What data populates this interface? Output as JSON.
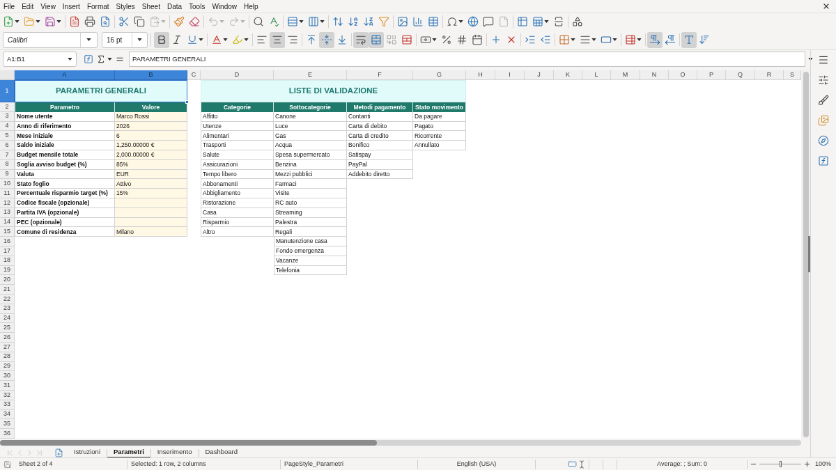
{
  "menu_bar": [
    "File",
    "Edit",
    "View",
    "Insert",
    "Format",
    "Styles",
    "Sheet",
    "Data",
    "Tools",
    "Window",
    "Help"
  ],
  "standard_toolbar": [
    [
      {
        "kind": "new-document",
        "disabled": false
      },
      {
        "kind": "open",
        "disabled": false
      },
      {
        "kind": "save",
        "disabled": false
      }
    ],
    [
      {
        "kind": "export-pdf",
        "disabled": false
      },
      {
        "kind": "print",
        "disabled": false
      },
      {
        "kind": "print-preview",
        "disabled": false
      }
    ],
    [
      {
        "kind": "cut",
        "disabled": false
      },
      {
        "kind": "copy",
        "disabled": false
      },
      {
        "kind": "paste",
        "disabled": true
      }
    ],
    [
      {
        "kind": "clone-formatting",
        "disabled": false
      },
      {
        "kind": "clear-formatting",
        "disabled": false
      }
    ],
    [
      {
        "kind": "undo",
        "disabled": true
      },
      {
        "kind": "redo",
        "disabled": true
      }
    ],
    [
      {
        "kind": "find-replace",
        "disabled": false
      },
      {
        "kind": "spelling",
        "disabled": false
      }
    ],
    [
      {
        "kind": "row",
        "disabled": false
      },
      {
        "kind": "column",
        "disabled": false
      }
    ],
    [
      {
        "kind": "sort",
        "disabled": false
      },
      {
        "kind": "sort-ascending",
        "disabled": false
      },
      {
        "kind": "sort-descending",
        "disabled": false
      },
      {
        "kind": "autofilter",
        "disabled": false
      }
    ],
    [
      {
        "kind": "image",
        "disabled": false
      },
      {
        "kind": "chart",
        "disabled": false
      },
      {
        "kind": "pivot-table",
        "disabled": false
      }
    ],
    [
      {
        "kind": "special-character",
        "disabled": false
      },
      {
        "kind": "hyperlink",
        "disabled": false
      },
      {
        "kind": "comment",
        "disabled": false
      },
      {
        "kind": "header-footer",
        "disabled": true
      }
    ],
    [
      {
        "kind": "print-area",
        "disabled": false
      },
      {
        "kind": "freeze",
        "disabled": false
      },
      {
        "kind": "split-window",
        "disabled": false
      }
    ],
    [
      {
        "kind": "shapes",
        "disabled": false
      }
    ]
  ],
  "formatting_toolbar": {
    "font_name": "Calibri",
    "font_size": "16 pt",
    "groups": [
      [
        {
          "kind": "bold",
          "on": true
        },
        {
          "kind": "italic",
          "on": false
        },
        {
          "kind": "underline",
          "on": false
        }
      ],
      [
        {
          "kind": "font-color",
          "on": false
        },
        {
          "kind": "highlighting",
          "on": false
        }
      ],
      [
        {
          "kind": "align-left",
          "on": false
        },
        {
          "kind": "align-center",
          "on": true
        },
        {
          "kind": "align-right",
          "on": false
        }
      ],
      [
        {
          "kind": "align-top",
          "on": false
        },
        {
          "kind": "align-middle",
          "on": true
        },
        {
          "kind": "align-bottom",
          "on": false
        }
      ],
      [
        {
          "kind": "wrap-text",
          "on": true
        },
        {
          "kind": "merge-center",
          "on": true
        },
        {
          "kind": "merge-cells",
          "on": false
        },
        {
          "kind": "unmerge-cells",
          "on": false
        }
      ],
      [
        {
          "kind": "currency",
          "on": false
        },
        {
          "kind": "percent",
          "on": false
        },
        {
          "kind": "number",
          "on": false
        },
        {
          "kind": "date",
          "on": false
        }
      ],
      [
        {
          "kind": "add-decimal",
          "on": false
        },
        {
          "kind": "delete-decimal",
          "on": false
        }
      ],
      [
        {
          "kind": "increase-indent",
          "on": false
        },
        {
          "kind": "decrease-indent",
          "on": false
        }
      ],
      [
        {
          "kind": "borders",
          "on": false
        },
        {
          "kind": "border-style",
          "on": false
        },
        {
          "kind": "border-color",
          "on": false
        }
      ],
      [
        {
          "kind": "conditional",
          "on": false
        }
      ],
      [
        {
          "kind": "left-to-right",
          "on": true
        },
        {
          "kind": "right-to-left",
          "on": false
        }
      ],
      [
        {
          "kind": "text-direction",
          "on": true
        },
        {
          "kind": "stacked-text",
          "on": false
        }
      ]
    ]
  },
  "formula_bar": {
    "name_box": "A1:B1",
    "content": "PARAMETRI GENERALI"
  },
  "sheet": {
    "columns": [
      {
        "label": "A",
        "selected": true
      },
      {
        "label": "B",
        "selected": true
      },
      {
        "label": "C",
        "selected": false
      },
      {
        "label": "D",
        "selected": false
      },
      {
        "label": "E",
        "selected": false
      },
      {
        "label": "F",
        "selected": false
      },
      {
        "label": "G",
        "selected": false
      },
      {
        "label": "H",
        "selected": false
      },
      {
        "label": "I",
        "selected": false
      },
      {
        "label": "J",
        "selected": false
      },
      {
        "label": "K",
        "selected": false
      },
      {
        "label": "L",
        "selected": false
      },
      {
        "label": "M",
        "selected": false
      },
      {
        "label": "N",
        "selected": false
      },
      {
        "label": "O",
        "selected": false
      },
      {
        "label": "P",
        "selected": false
      },
      {
        "label": "Q",
        "selected": false
      },
      {
        "label": "R",
        "selected": false
      },
      {
        "label": "S",
        "selected": false
      }
    ],
    "rows": [
      {
        "label": "1",
        "selected": true
      },
      {
        "label": "2",
        "selected": false
      },
      {
        "label": "3",
        "selected": false
      },
      {
        "label": "4",
        "selected": false
      },
      {
        "label": "5",
        "selected": false
      },
      {
        "label": "6",
        "selected": false
      },
      {
        "label": "7",
        "selected": false
      },
      {
        "label": "8",
        "selected": false
      },
      {
        "label": "9",
        "selected": false
      },
      {
        "label": "10",
        "selected": false
      },
      {
        "label": "11",
        "selected": false
      },
      {
        "label": "12",
        "selected": false
      },
      {
        "label": "13",
        "selected": false
      },
      {
        "label": "14",
        "selected": false
      },
      {
        "label": "15",
        "selected": false
      },
      {
        "label": "16",
        "selected": false
      },
      {
        "label": "17",
        "selected": false
      },
      {
        "label": "18",
        "selected": false
      },
      {
        "label": "19",
        "selected": false
      },
      {
        "label": "20",
        "selected": false
      },
      {
        "label": "21",
        "selected": false
      },
      {
        "label": "22",
        "selected": false
      },
      {
        "label": "23",
        "selected": false
      },
      {
        "label": "24",
        "selected": false
      },
      {
        "label": "25",
        "selected": false
      },
      {
        "label": "26",
        "selected": false
      },
      {
        "label": "27",
        "selected": false
      },
      {
        "label": "28",
        "selected": false
      },
      {
        "label": "29",
        "selected": false
      },
      {
        "label": "30",
        "selected": false
      },
      {
        "label": "31",
        "selected": false
      },
      {
        "label": "32",
        "selected": false
      },
      {
        "label": "33",
        "selected": false
      },
      {
        "label": "34",
        "selected": false
      },
      {
        "label": "35",
        "selected": false
      },
      {
        "label": "36",
        "selected": false
      }
    ],
    "parameters_table": {
      "title": {
        "text": "PARAMETRI GENERALI",
        "selected": true
      },
      "headers": [
        "Parametro",
        "Valore"
      ],
      "rows": [
        {
          "parameter": "Nome utente",
          "value": "Marco Rossi"
        },
        {
          "parameter": "Anno di riferimento",
          "value": "2026"
        },
        {
          "parameter": "Mese iniziale",
          "value": "6"
        },
        {
          "parameter": "Saldo iniziale",
          "value": "1,250.00000 €"
        },
        {
          "parameter": "Budget mensile totale",
          "value": "2,000.00000 €"
        },
        {
          "parameter": "Soglia avviso budget (%)",
          "value": "85%"
        },
        {
          "parameter": "Valuta",
          "value": "EUR"
        },
        {
          "parameter": "Stato foglio",
          "value": "Attivo"
        },
        {
          "parameter": "Percentuale risparmio target (%)",
          "value": "15%"
        },
        {
          "parameter": "Codice fiscale (opzionale)"
        },
        {
          "parameter": "Partita IVA (opzionale)"
        },
        {
          "parameter": "PEC (opzionale)"
        },
        {
          "parameter": "Comune di residenza",
          "value": "Milano"
        }
      ]
    },
    "validation_lists": {
      "title": {
        "text": "LISTE DI VALIDAZIONE",
        "selected": false
      },
      "lists": [
        {
          "header": "Categorie",
          "items": [
            "Affitto",
            "Utenze",
            "Alimentari",
            "Trasporti",
            "Salute",
            "Assicurazioni",
            "Tempo libero",
            "Abbonamenti",
            "Abbigliamento",
            "Ristorazione",
            "Casa",
            "Risparmio",
            "Altro"
          ]
        },
        {
          "header": "Sottocategorie",
          "items": [
            "Canone",
            "Luce",
            "Gas",
            "Acqua",
            "Spesa supermercato",
            "Benzina",
            "Mezzi pubblici",
            "Farmaci",
            "Visite",
            "RC auto",
            "Streaming",
            "Palestra",
            "Regali",
            "Manutenzione casa",
            "Fondo emergenza",
            "Vacanze",
            "Telefonia"
          ]
        },
        {
          "header": "Metodi pagamento",
          "items": [
            "Contanti",
            "Carta di debito",
            "Carta di credito",
            "Bonifico",
            "Satispay",
            "PayPal",
            "Addebito diretto"
          ]
        },
        {
          "header": "Stato movimento",
          "items": [
            "Da pagare",
            "Pagato",
            "Ricorrente",
            "Annullato"
          ]
        }
      ]
    }
  },
  "sheet_navigation": [
    {
      "kind": "first",
      "disabled": true
    },
    {
      "kind": "previous",
      "disabled": true
    },
    {
      "kind": "next",
      "disabled": true
    },
    {
      "kind": "last",
      "disabled": true
    }
  ],
  "sheet_tabs": [
    {
      "label": "Istruzioni",
      "selected": false
    },
    {
      "label": "Parametri",
      "selected": true
    },
    {
      "label": "Inserimento",
      "selected": false
    },
    {
      "label": "Dashboard",
      "selected": false
    }
  ],
  "status_bar": {
    "sheet": "Sheet 2 of 4",
    "selection": "Selected: 1 row, 2 columns",
    "page_style": "PageStyle_Parametri",
    "language": "English (USA)",
    "summary": "Average: ; Sum: 0",
    "zoom_slider": {
      "level": 0.5
    },
    "zoom": "100%"
  }
}
